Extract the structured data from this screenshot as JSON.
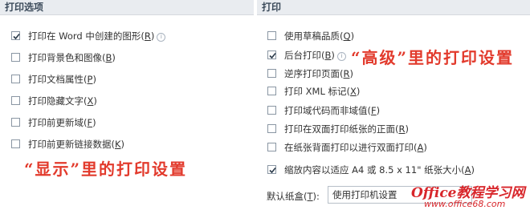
{
  "left": {
    "header": "打印选项",
    "options": [
      {
        "text": "打印在 Word 中创建的图形",
        "key": "R",
        "checked": true,
        "info": true
      },
      {
        "text": "打印背景色和图像",
        "key": "B",
        "checked": false,
        "info": false
      },
      {
        "text": "打印文档属性",
        "key": "P",
        "checked": false,
        "info": false
      },
      {
        "text": "打印隐藏文字",
        "key": "X",
        "checked": false,
        "info": false
      },
      {
        "text": "打印前更新域",
        "key": "F",
        "checked": false,
        "info": false
      },
      {
        "text": "打印前更新链接数据",
        "key": "K",
        "checked": false,
        "info": false
      }
    ],
    "annotation": "“显示”里的打印设置"
  },
  "right": {
    "header": "打印",
    "options": [
      {
        "text": "使用草稿品质",
        "key": "Q",
        "checked": false,
        "info": false
      },
      {
        "text": "后台打印",
        "key": "B",
        "checked": true,
        "info": true
      },
      {
        "text": "逆序打印页面",
        "key": "R",
        "checked": false,
        "info": false
      },
      {
        "text": "打印 XML 标记",
        "key": "X",
        "checked": false,
        "info": false
      },
      {
        "text": "打印域代码而非域值",
        "key": "F",
        "checked": false,
        "info": false
      },
      {
        "text": "打印在双面打印纸张的正面",
        "key": "R",
        "checked": false,
        "info": false
      },
      {
        "text": "在纸张背面打印以进行双面打印",
        "key": "A",
        "checked": false,
        "info": false
      },
      {
        "text": "缩放内容以适应 A4 或 8.5 x 11\" 纸张大小",
        "key": "A",
        "checked": true,
        "info": false
      }
    ],
    "annotation": "“高级”里的打印设置",
    "tray": {
      "label": "默认纸盒",
      "key": "T",
      "value": "使用打印机设置"
    }
  },
  "watermark": {
    "brand": "Office教程学习网",
    "url": "www.office68.com"
  },
  "colors": {
    "annotation": "#e23a2c",
    "header_bg": "#e9ecf0",
    "checkbox_border": "#8a96a3",
    "check_mark": "#2b3a4a"
  },
  "icons": {
    "checked": "check-icon",
    "info": "info-icon"
  }
}
